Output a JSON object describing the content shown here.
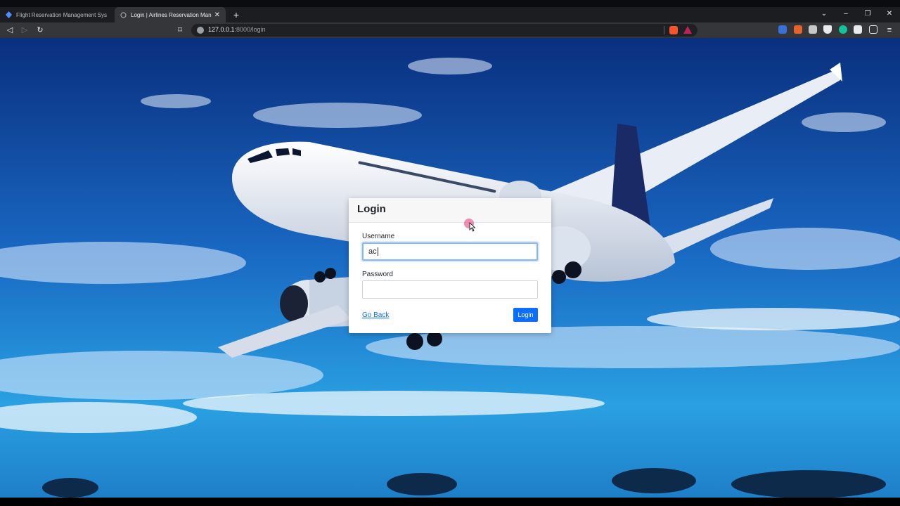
{
  "browser": {
    "tabs": [
      {
        "title": "Flight Reservation Management Syste",
        "active": false,
        "favicon": "app-icon"
      },
      {
        "title": "Login | Airlines Reservation Mana",
        "active": true,
        "favicon": "loading-icon"
      }
    ],
    "url_host": "127.0.0.1",
    "url_path": ":8000/login",
    "new_tab_symbol": "+",
    "close_symbol": "✕"
  },
  "login": {
    "title": "Login",
    "username_label": "Username",
    "username_value": "ac",
    "password_label": "Password",
    "password_value": "",
    "back_link": "Go Back",
    "submit_label": "Login"
  },
  "colors": {
    "primary": "#0d6efd",
    "sky_top": "#0b3a8c",
    "sky_bottom": "#2a9be0"
  }
}
